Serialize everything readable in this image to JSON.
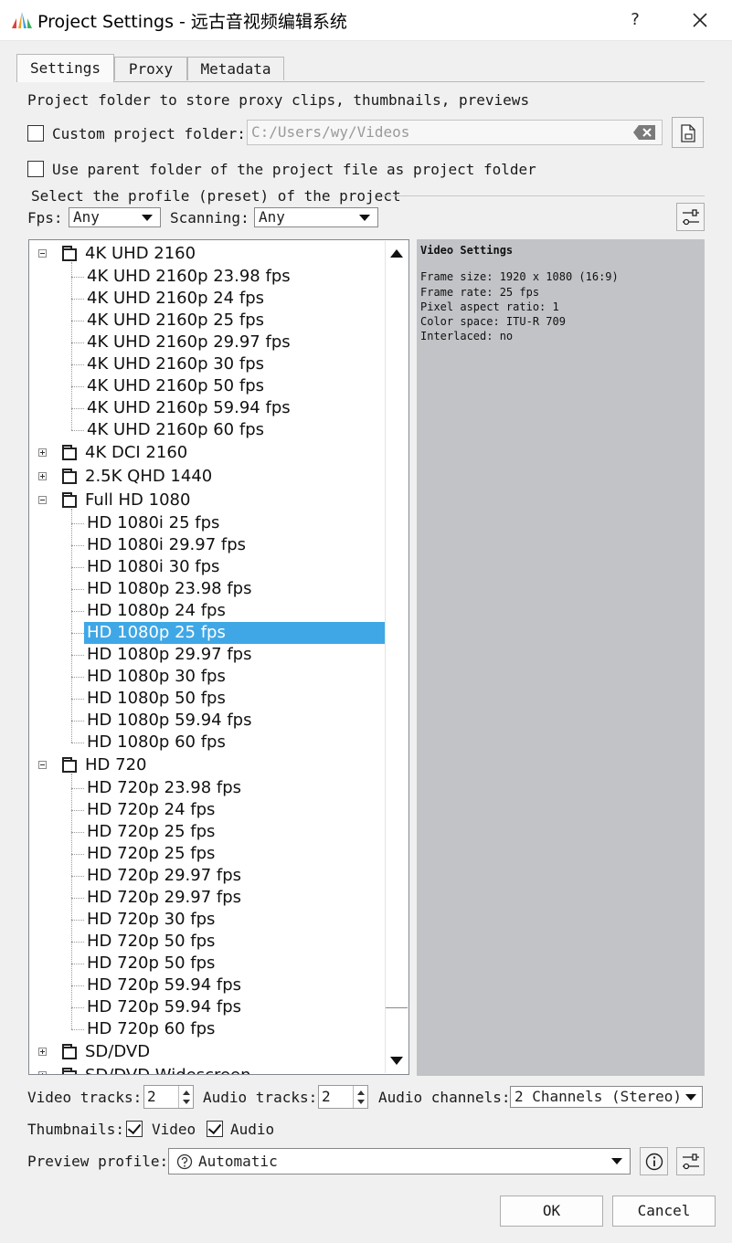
{
  "window": {
    "title": "Project Settings - 远古音视频编辑系统",
    "help_label": "?"
  },
  "tabs": [
    {
      "label": "Settings",
      "active": true
    },
    {
      "label": "Proxy",
      "active": false
    },
    {
      "label": "Metadata",
      "active": false
    }
  ],
  "settings": {
    "folder_heading": "Project folder to store proxy clips, thumbnails, previews",
    "custom_folder_label": "Custom project folder:",
    "custom_folder_checked": false,
    "custom_folder_value": "C:/Users/wy/Videos",
    "parent_folder_label": "Use parent folder of the project file as project folder",
    "parent_folder_checked": false,
    "profile_group_label": "Select the profile (preset) of the project",
    "fps_label": "Fps:",
    "fps_value": "Any",
    "scanning_label": "Scanning:",
    "scanning_value": "Any"
  },
  "profile_tree": [
    {
      "type": "group",
      "label": "4K UHD 2160",
      "expanded": true,
      "children": [
        "4K UHD 2160p 23.98 fps",
        "4K UHD 2160p 24 fps",
        "4K UHD 2160p 25 fps",
        "4K UHD 2160p 29.97 fps",
        "4K UHD 2160p 30 fps",
        "4K UHD 2160p 50 fps",
        "4K UHD 2160p 59.94 fps",
        "4K UHD 2160p 60 fps"
      ]
    },
    {
      "type": "group",
      "label": "4K DCI 2160",
      "expanded": false,
      "children": []
    },
    {
      "type": "group",
      "label": "2.5K QHD 1440",
      "expanded": false,
      "children": []
    },
    {
      "type": "group",
      "label": "Full HD 1080",
      "expanded": true,
      "children": [
        "HD 1080i 25 fps",
        "HD 1080i 29.97 fps",
        "HD 1080i 30 fps",
        "HD 1080p 23.98 fps",
        "HD 1080p 24 fps",
        "HD 1080p 25 fps",
        "HD 1080p 29.97 fps",
        "HD 1080p 30 fps",
        "HD 1080p 50 fps",
        "HD 1080p 59.94 fps",
        "HD 1080p 60 fps"
      ]
    },
    {
      "type": "group",
      "label": "HD 720",
      "expanded": true,
      "children": [
        "HD 720p 23.98 fps",
        "HD 720p 24 fps",
        "HD 720p 25 fps",
        "HD 720p 25 fps",
        "HD 720p 29.97 fps",
        "HD 720p 29.97 fps",
        "HD 720p 30 fps",
        "HD 720p 50 fps",
        "HD 720p 50 fps",
        "HD 720p 59.94 fps",
        "HD 720p 59.94 fps",
        "HD 720p 60 fps"
      ]
    },
    {
      "type": "group",
      "label": "SD/DVD",
      "expanded": false,
      "children": []
    },
    {
      "type": "group",
      "label": "SD/DVD Widescreen",
      "expanded": false,
      "children": []
    }
  ],
  "selected_profile": "HD 1080p 25 fps",
  "video_settings": {
    "heading": "Video Settings",
    "lines": [
      "Frame size: 1920 x 1080 (16:9)",
      "Frame rate: 25 fps",
      "Pixel aspect ratio: 1",
      "Color space: ITU-R 709",
      "Interlaced: no"
    ]
  },
  "tracks": {
    "video_label": "Video tracks:",
    "video_value": "2",
    "audio_label": "Audio tracks:",
    "audio_value": "2",
    "channels_label": "Audio channels:",
    "channels_value": "2 Channels (Stereo)"
  },
  "thumbnails": {
    "label": "Thumbnails:",
    "video_label": "Video",
    "video_checked": true,
    "audio_label": "Audio",
    "audio_checked": true
  },
  "preview_profile": {
    "label": "Preview profile:",
    "value": "Automatic"
  },
  "buttons": {
    "ok": "OK",
    "cancel": "Cancel"
  },
  "colors": {
    "selection": "#3fa7e6",
    "preview_bg": "#c2c3c6",
    "dialog_bg": "#f0f0f0"
  }
}
